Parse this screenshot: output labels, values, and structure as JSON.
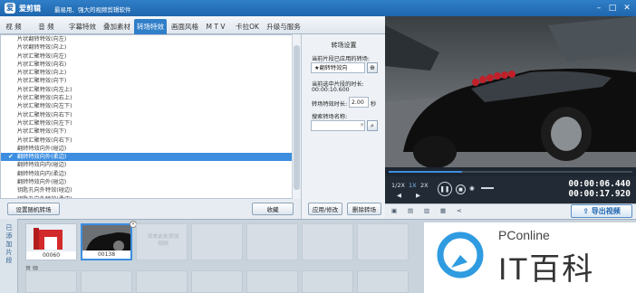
{
  "title": {
    "app_name": "爱剪辑",
    "slogan": "最易用、强大的视频剪辑软件"
  },
  "tabs": [
    {
      "label": "视 频"
    },
    {
      "label": "音 频"
    },
    {
      "label": "字幕特效"
    },
    {
      "label": "叠加素材"
    },
    {
      "label": "转场特效",
      "active": true
    },
    {
      "label": "画面风格"
    },
    {
      "label": "M T V"
    },
    {
      "label": "卡拉OK"
    },
    {
      "label": "升级与服务"
    }
  ],
  "transitions": [
    "片状翻转特效(向左)",
    "片状翻转特效(向上)",
    "片状汇聚特效(向左)",
    "片状汇聚特效(向右)",
    "片状汇聚特效(向上)",
    "片状汇聚特效(向下)",
    "片状汇聚特效(向左上)",
    "片状汇聚特效(向右上)",
    "片状汇聚特效(向左下)",
    "片状汇聚特效(向右下)",
    "片状汇聚特效(向左下)",
    "片状汇聚特效(向下)",
    "片状汇聚特效(向右下)",
    "翻转特效向外(碰边)",
    "翻转特效向外(柔边)",
    "翻转特效向内(碰边)",
    "翻转特效向内(柔边)",
    "翻转特效向外(碰边)",
    "钥匙孔向外特效(碰边)",
    "钥匙孔向外特效(柔边)",
    "钥匙孔向内特效(碰边)"
  ],
  "selected_index": 14,
  "left_buttons": {
    "random": "设置随机转场",
    "collect": "收藏"
  },
  "settings": {
    "title": "转场设置",
    "current_label": "当前片段已应用的转场:",
    "current_value": "翻转特效向",
    "duration_label": "当前选中片段的时长:",
    "duration_value": "00:00:10.600",
    "trans_duration_label": "转场特效时长:",
    "trans_duration_value": "2.00",
    "seconds": "秒",
    "search_label": "搜索转场名称:",
    "search_value": "",
    "apply": "应用/修改",
    "delete": "删除转场"
  },
  "player": {
    "speeds": [
      "1/2X",
      "1X",
      "2X"
    ],
    "time_current": "00:00:06.440",
    "time_total": "00:00:17.920",
    "progress": 0.3
  },
  "export_label": "导出视频",
  "timeline": {
    "side_label": "已添加片段",
    "clips": [
      {
        "label": "00060"
      },
      {
        "label": "00138"
      }
    ],
    "placeholder_text": "双击此处添加视频",
    "audio_label": "音 频"
  },
  "watermark": {
    "brand": "PConline",
    "mark": "IT百科"
  },
  "colors": {
    "accent": "#2f7fc8",
    "selected": "#3d8ee0"
  }
}
